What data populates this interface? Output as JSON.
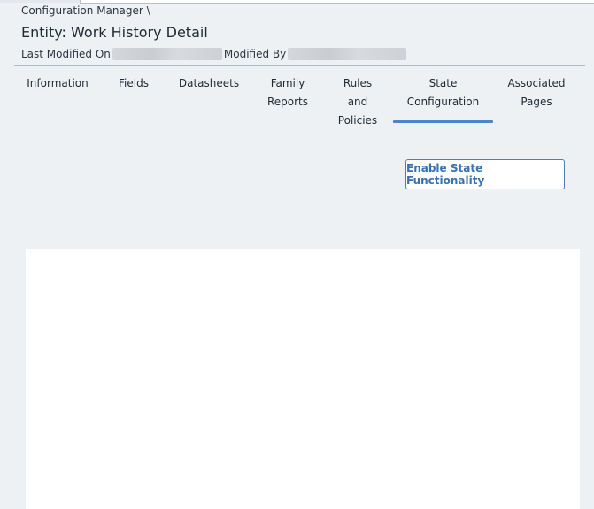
{
  "header": {
    "breadcrumb": "Configuration Manager \\",
    "title": "Entity: Work History Detail",
    "last_modified_on_label": "Last Modified On",
    "modified_by_label": "Modified By"
  },
  "tabs": [
    {
      "lines": [
        "Information"
      ]
    },
    {
      "lines": [
        "Fields"
      ]
    },
    {
      "lines": [
        "Datasheets"
      ]
    },
    {
      "lines": [
        "Family",
        "Reports"
      ]
    },
    {
      "lines": [
        "Rules",
        "and",
        "Policies"
      ]
    },
    {
      "lines": [
        "State",
        "Configuration"
      ],
      "active": true
    },
    {
      "lines": [
        "Associated",
        "Pages"
      ]
    }
  ],
  "actions": {
    "enable_state_label": "Enable State Functionality"
  },
  "colors": {
    "accent": "#4a86c5",
    "background": "#eef1f4"
  }
}
